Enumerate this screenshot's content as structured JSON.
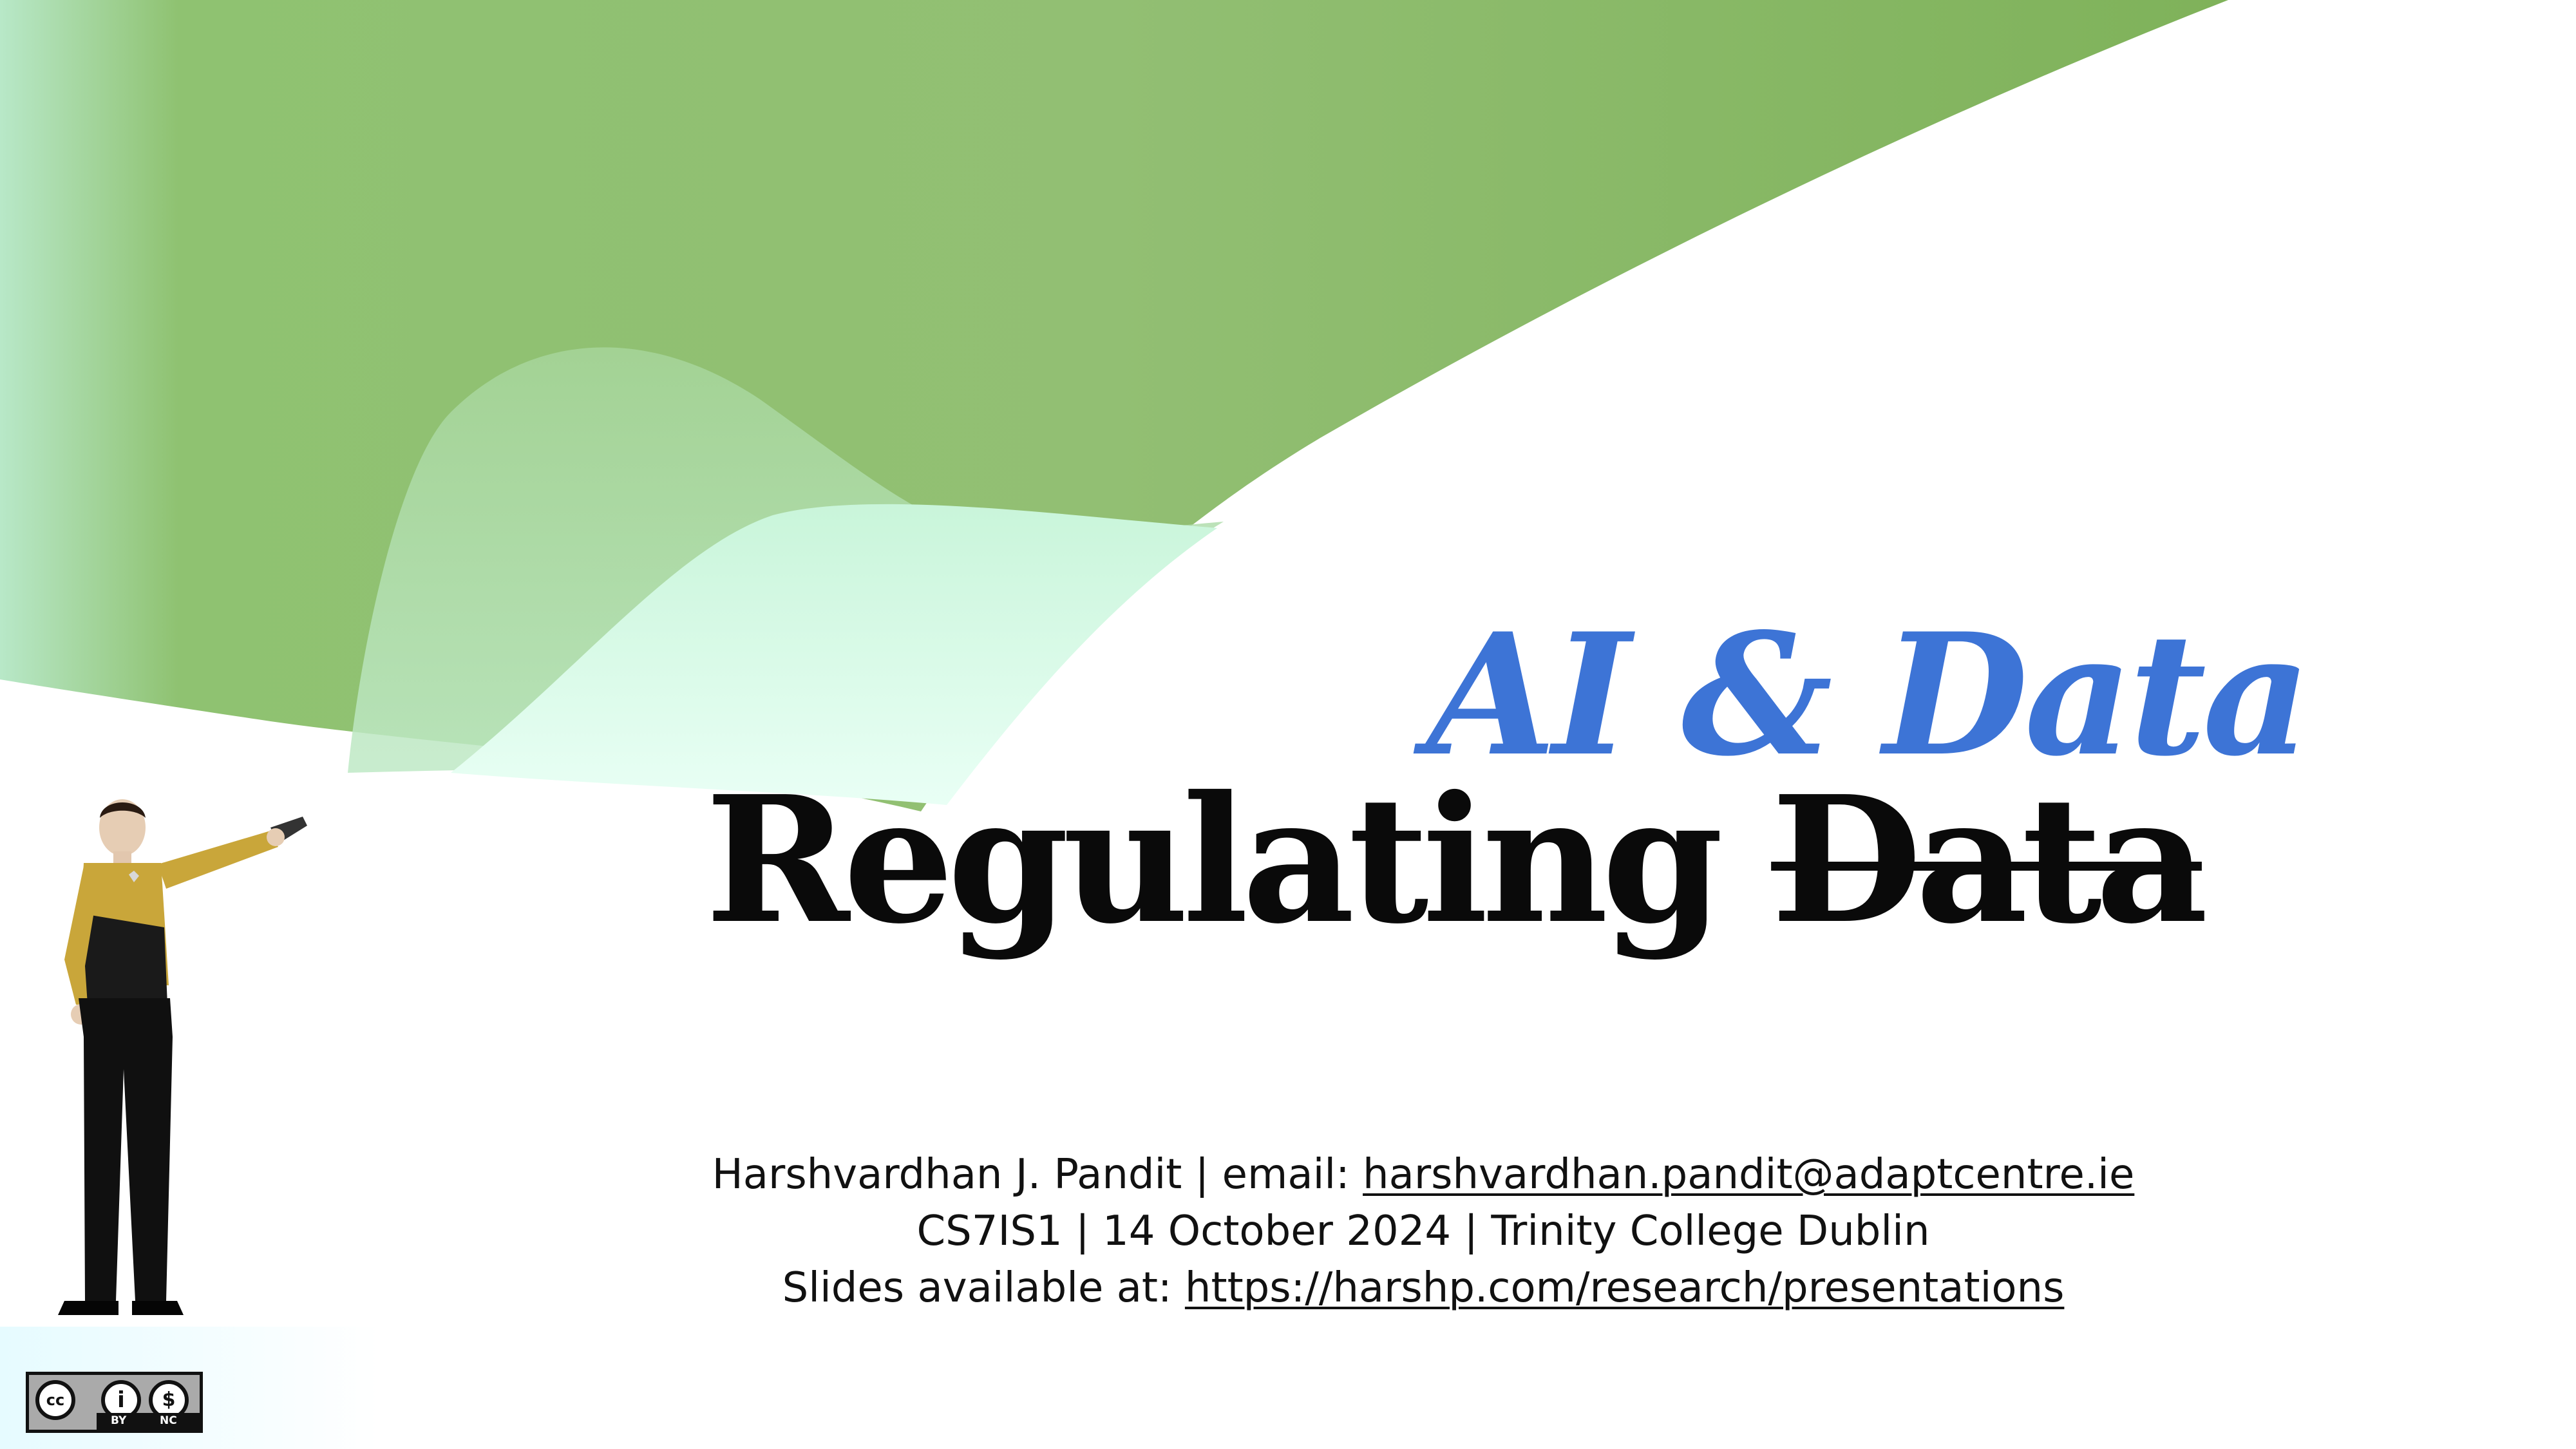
{
  "slide": {
    "title_top": "AI & Data",
    "title_main": "Regulating",
    "title_struck": "Data",
    "credits": {
      "author_line_prefix": "Harshvardhan J. Pandit | email: ",
      "email": "harshvardhan.pandit@adaptcentre.ie",
      "course_line": "CS7IS1 | 14 October 2024 | Trinity College Dublin",
      "slides_line_prefix": "Slides available at: ",
      "slides_url": "https://harshp.com/research/presentations"
    },
    "license": {
      "cc": "cc",
      "by": "BY",
      "nc": "NC"
    }
  },
  "colors": {
    "accent_blue": "#3d74d6",
    "wave_green": "#86b865",
    "wave_mint": "#c6f3d9",
    "title_black": "#0a0a0a"
  },
  "icons": {
    "figure": "officer-figure-illustration",
    "license": "cc-by-nc-badge"
  }
}
